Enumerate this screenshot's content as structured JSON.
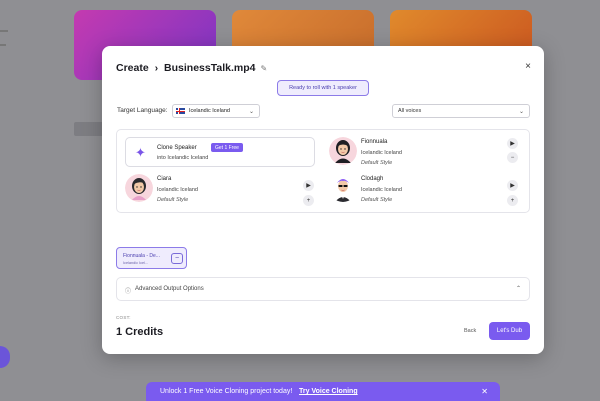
{
  "header": {
    "create_label": "Create",
    "chevron": "›",
    "filename": "BusinessTalk.mp4",
    "edit_icon": "pencil-icon",
    "close_icon": "close-icon",
    "close_glyph": "×"
  },
  "status": {
    "ready_text": "Ready to roll with 1 speaker"
  },
  "target_language": {
    "label": "Target Language:",
    "value": "Icelandic Iceland",
    "flag": "iceland-flag-icon"
  },
  "voice_filter": {
    "value": "All voices"
  },
  "clone_speaker": {
    "title": "Clone Speaker",
    "badge": "Get 1 Free",
    "subtitle": "into Icelandic Iceland",
    "icon": "sparkle-icon"
  },
  "speakers": [
    {
      "name": "Fionnuala",
      "language": "Icelandic Iceland",
      "style": "Default Style",
      "action": "−"
    },
    {
      "name": "Ciara",
      "language": "Icelandic Iceland",
      "style": "Default Style",
      "action": "+"
    },
    {
      "name": "Clodagh",
      "language": "Icelandic Iceland",
      "style": "Default Style",
      "action": "+"
    }
  ],
  "play_glyph": "▶",
  "selected_chip": {
    "name": "Fionnuala - De...",
    "sub": "Icelandic Icel...",
    "remove_glyph": "−"
  },
  "advanced": {
    "info_glyph": "ⓘ",
    "label": "Advanced Output Options",
    "chevron": "⌃"
  },
  "footer": {
    "cost_label": "COST:",
    "credits": "1 Credits",
    "back_label": "Back",
    "dub_label": "Let's Dub"
  },
  "banner": {
    "text": "Unlock 1 Free Voice Cloning project today!",
    "link": "Try Voice Cloning",
    "close_glyph": "✕"
  },
  "colors": {
    "accent": "#7a5bef",
    "backdrop": "#8f8f93"
  }
}
